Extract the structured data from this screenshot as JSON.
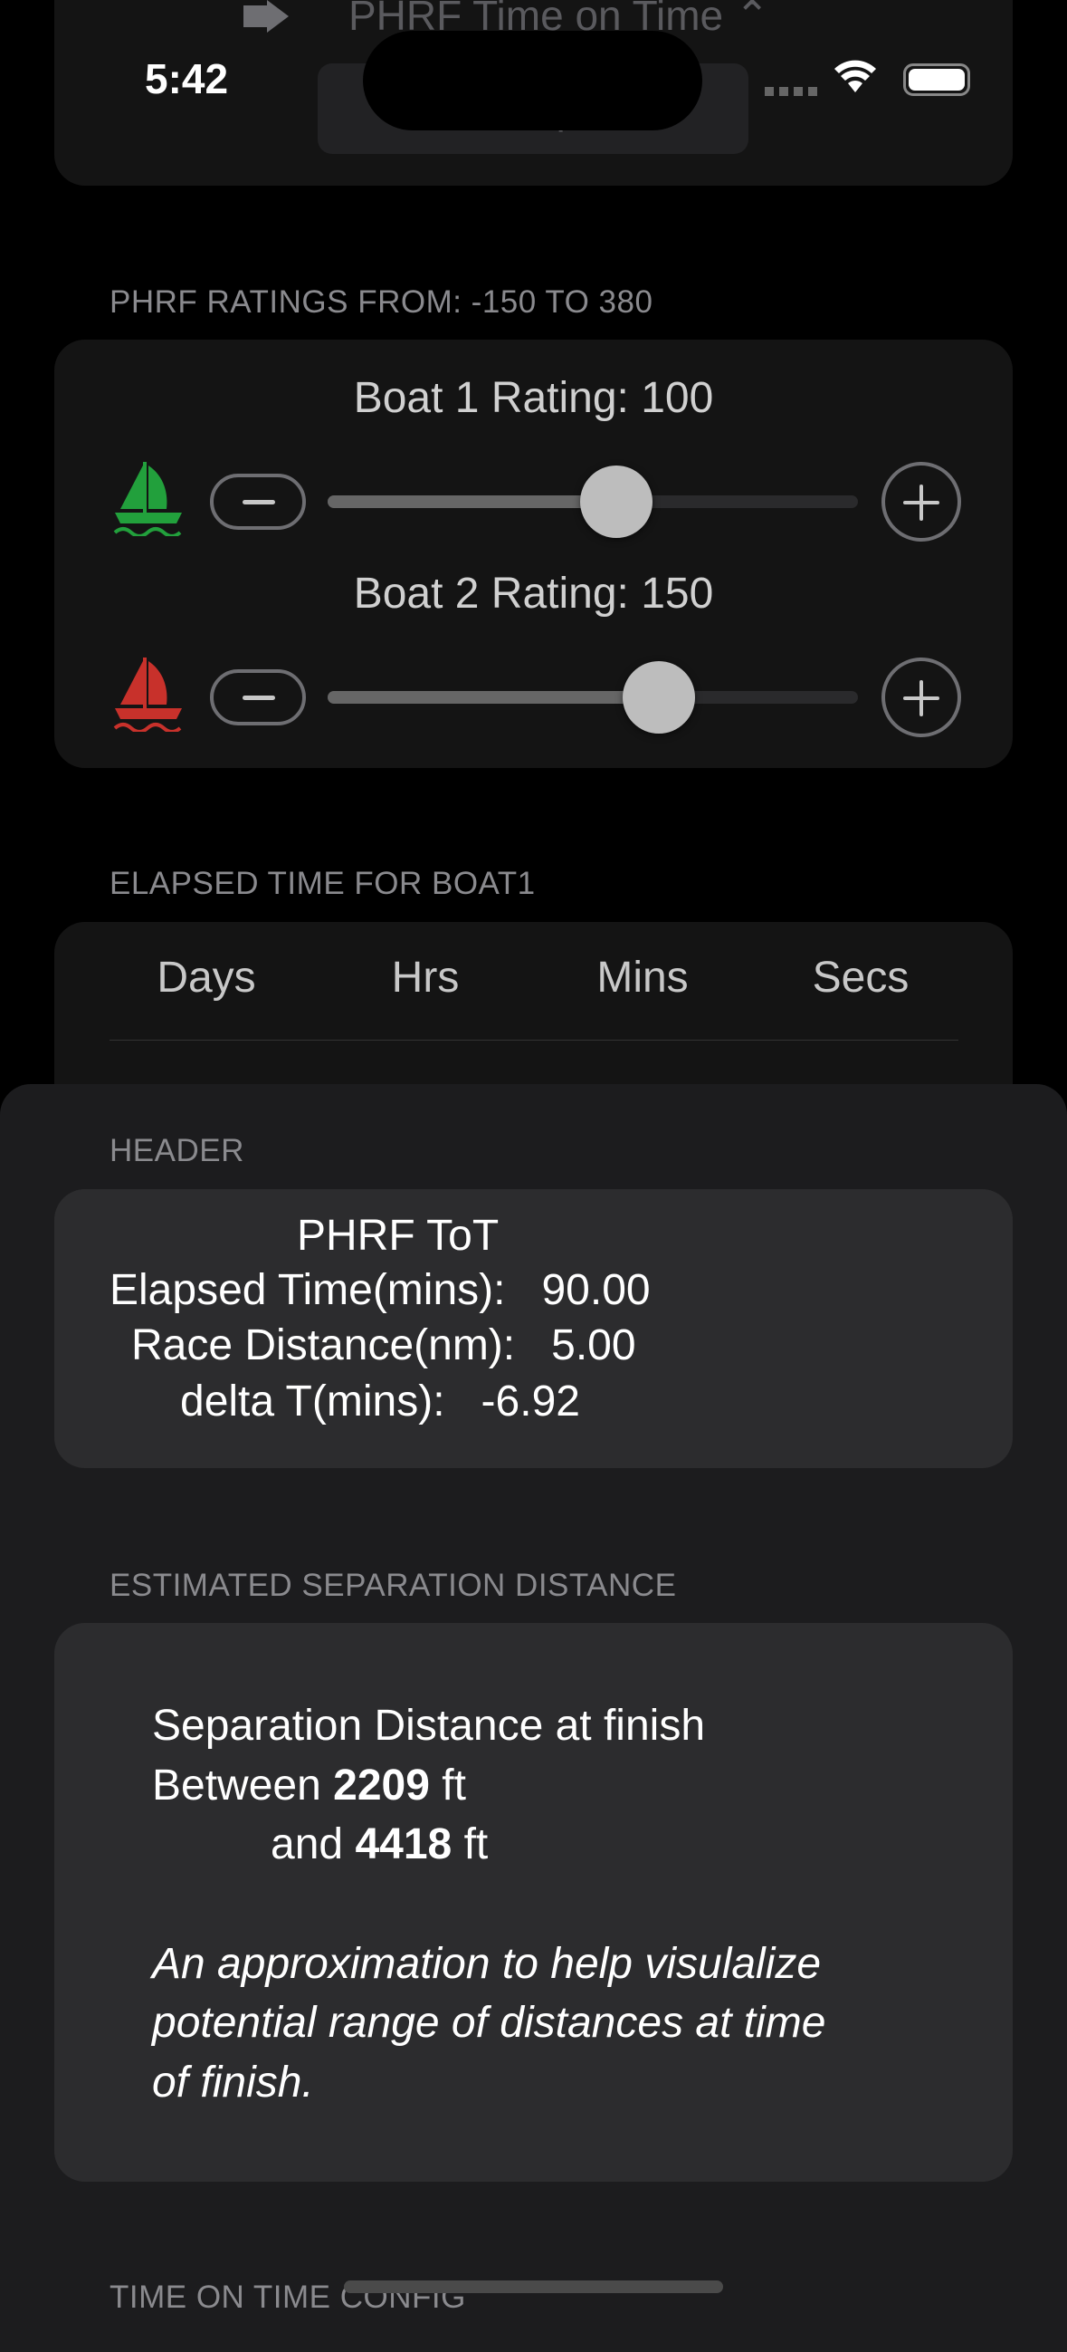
{
  "status_bar": {
    "time": "5:42"
  },
  "top_card": {
    "mode_icon": "arrow-right-icon",
    "mode_label": "PHRF Time on Time",
    "mode_chevron": "chevron-up-down-icon",
    "button_label": "PHRF Options"
  },
  "ratings": {
    "section_label": "PHRF  RATINGS FROM: -150 TO  380",
    "min": -150,
    "max": 380,
    "boats": [
      {
        "label": "Boat 1 Rating: 100",
        "value": 100,
        "icon": "sailboat-icon",
        "color": "#22a03c"
      },
      {
        "label": "Boat 2 Rating: 150",
        "value": 150,
        "icon": "sailboat-icon",
        "color": "#c8312b"
      }
    ]
  },
  "elapsed": {
    "section_label": "ELAPSED TIME FOR BOAT1",
    "columns": [
      "Days",
      "Hrs",
      "Mins",
      "Secs"
    ]
  },
  "sheet": {
    "header_label": "HEADER",
    "summary": {
      "title": "PHRF ToT",
      "elapsed_label": "Elapsed Time(mins):",
      "elapsed_value": "90.00",
      "distance_label": "Race Distance(nm):",
      "distance_value": "5.00",
      "delta_label": "delta T(mins):",
      "delta_value": "-6.92"
    },
    "separation_label": "ESTIMATED SEPARATION DISTANCE",
    "separation": {
      "line1": "Separation Distance at finish",
      "between": "Between",
      "low": "2209",
      "unit": "ft",
      "and": "and",
      "high": "4418",
      "note_lines": [
        "An approximation to help visulalize",
        "potential range of distances at time",
        "of finish."
      ]
    },
    "config_label": "TIME ON TIME CONFIG"
  }
}
